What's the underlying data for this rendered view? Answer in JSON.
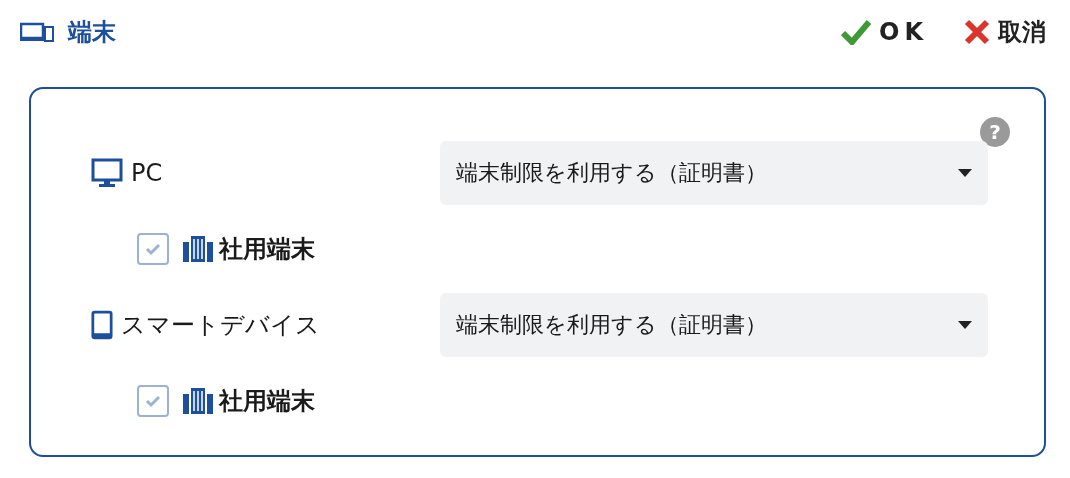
{
  "header": {
    "title": "端末",
    "ok": "OK",
    "cancel": "取消"
  },
  "help": "?",
  "devices": [
    {
      "kind": "monitor",
      "label": "PC",
      "select": "端末制限を利用する（証明書）",
      "option": {
        "label": "社用端末",
        "checked": true,
        "disabled": true
      }
    },
    {
      "kind": "tablet",
      "label": "スマートデバイス",
      "select": "端末制限を利用する（証明書）",
      "option": {
        "label": "社用端末",
        "checked": true,
        "disabled": true
      }
    }
  ]
}
